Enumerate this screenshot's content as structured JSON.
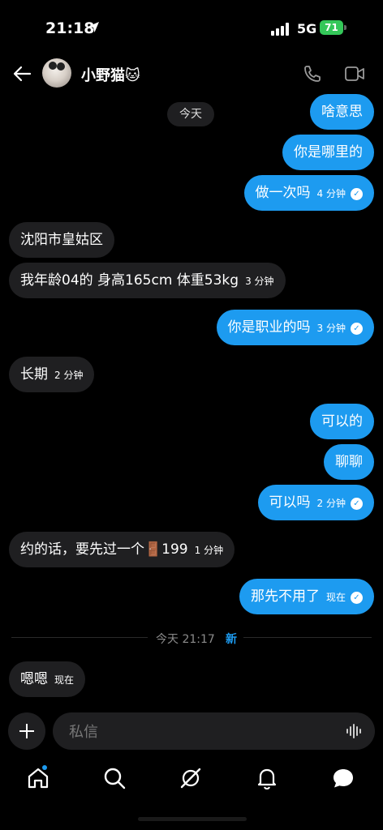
{
  "status": {
    "time": "21:18",
    "network": "5G",
    "battery": "71"
  },
  "header": {
    "name": "小野猫🐱",
    "back_icon": "arrow-left-icon",
    "call_icon": "phone-icon",
    "video_icon": "video-icon"
  },
  "chat": {
    "date_pill": "今天",
    "messages": [
      {
        "dir": "out",
        "text": "啥意思"
      },
      {
        "dir": "out",
        "text": "你是哪里的"
      },
      {
        "dir": "out",
        "text": "做一次吗",
        "time": "4 分钟",
        "read": true
      },
      {
        "dir": "in",
        "text": "沈阳市皇姑区"
      },
      {
        "dir": "in",
        "text": "我年龄04的  身高165cm   体重53kg",
        "time": "3 分钟"
      },
      {
        "dir": "out",
        "text": "你是职业的吗",
        "time": "3 分钟",
        "read": true
      },
      {
        "dir": "in",
        "text": "长期",
        "time": "2 分钟"
      },
      {
        "dir": "out",
        "text": "可以的"
      },
      {
        "dir": "out",
        "text": "聊聊"
      },
      {
        "dir": "out",
        "text": "可以吗",
        "time": "2 分钟",
        "read": true
      },
      {
        "dir": "in",
        "text": "约的话，要先过一个🚪199",
        "time": "1 分钟"
      },
      {
        "dir": "out",
        "text": "那先不用了",
        "time": "现在",
        "read": true
      },
      {
        "dir": "in",
        "text": "嗯嗯",
        "time": "现在"
      }
    ],
    "separator": {
      "text": "今天 21:17",
      "new_label": "新"
    }
  },
  "composer": {
    "placeholder": "私信"
  },
  "tabs": [
    {
      "icon": "home-icon"
    },
    {
      "icon": "search-icon"
    },
    {
      "icon": "grok-icon"
    },
    {
      "icon": "bell-icon"
    },
    {
      "icon": "messages-icon"
    }
  ],
  "colors": {
    "accent": "#1d9bf0",
    "incoming_bubble": "#1f1f21",
    "background": "#000000",
    "battery": "#34c759"
  }
}
